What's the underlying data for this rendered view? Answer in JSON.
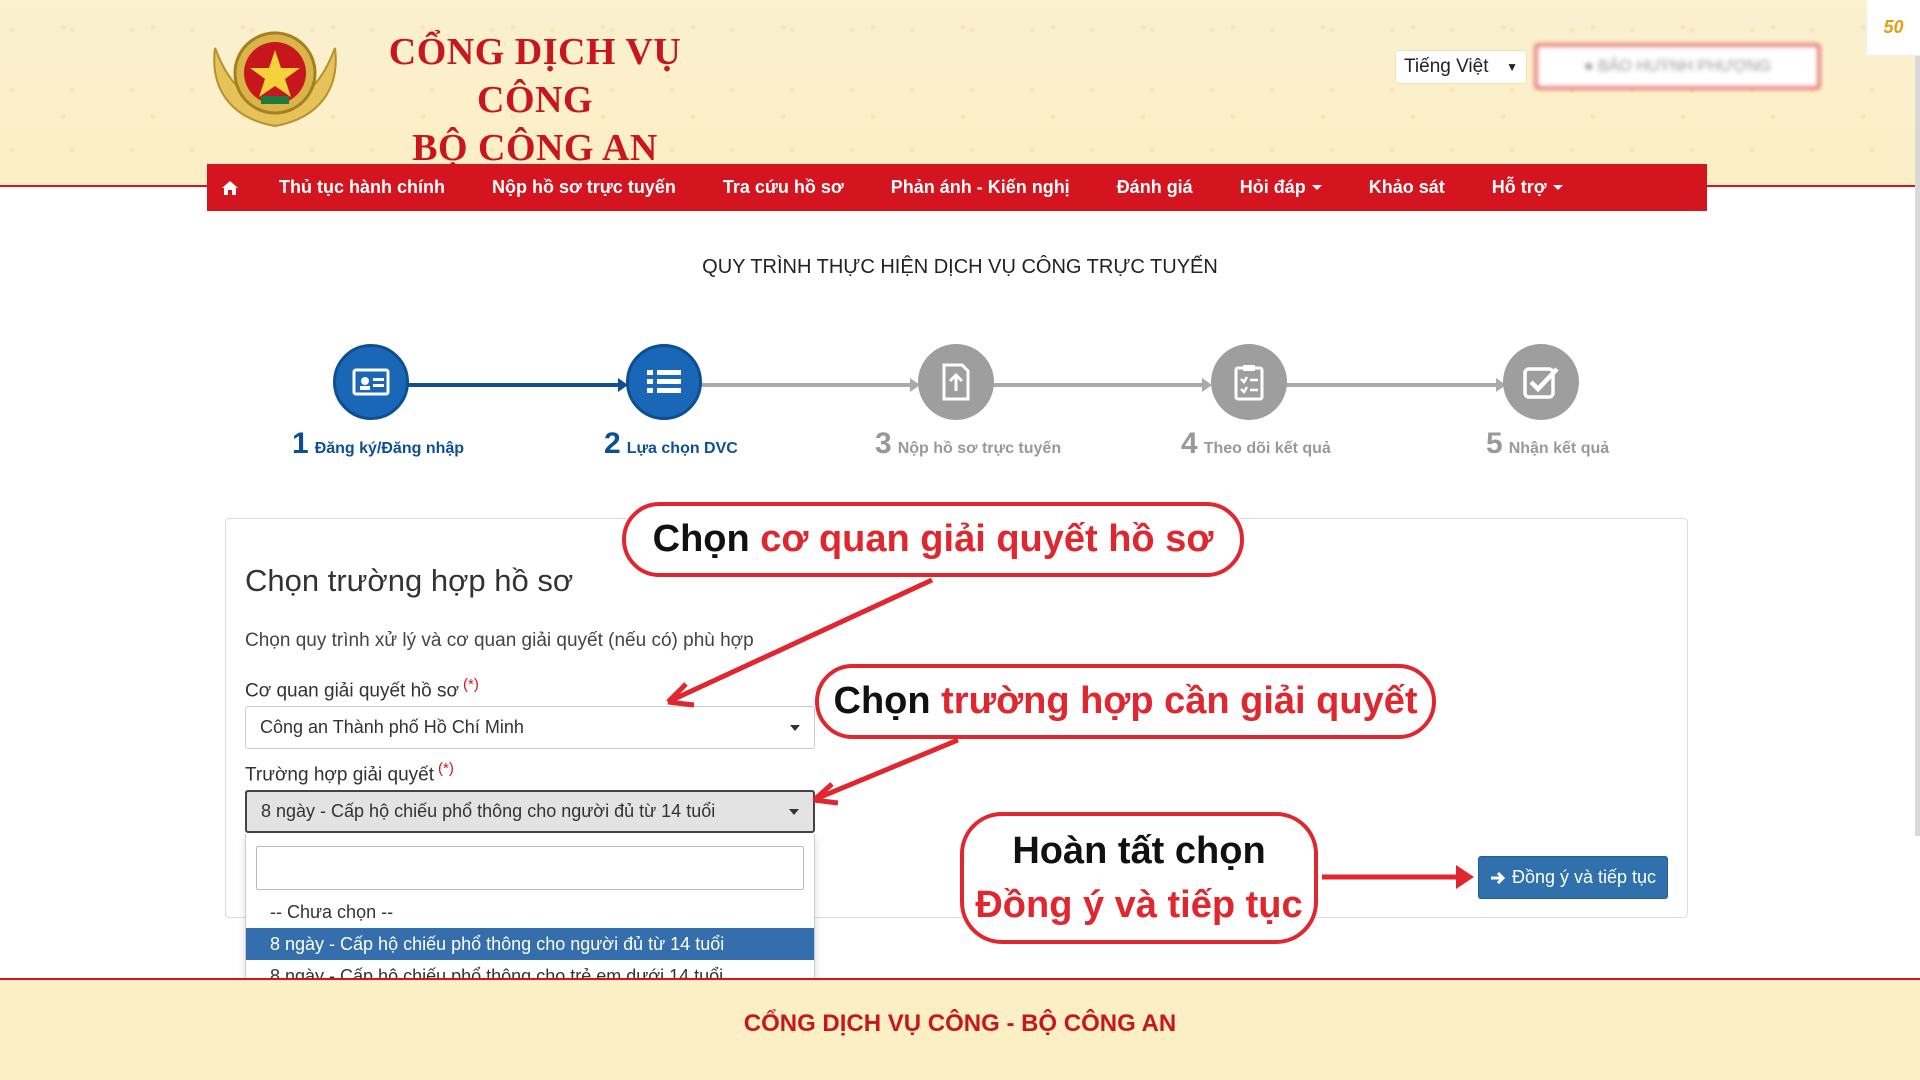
{
  "header": {
    "site_title_line1": "CỔNG DỊCH VỤ CÔNG",
    "site_title_line2": "BỘ CÔNG AN",
    "language": "Tiếng Việt",
    "user_name": "BẢO HUỲNH PHƯỢNG"
  },
  "nav": {
    "home_icon": "home-icon",
    "items": [
      {
        "label": "Thủ tục hành chính"
      },
      {
        "label": "Nộp hồ sơ trực tuyến"
      },
      {
        "label": "Tra cứu hồ sơ"
      },
      {
        "label": "Phản ánh - Kiến nghị"
      },
      {
        "label": "Đánh giá"
      },
      {
        "label": "Hỏi đáp",
        "has_dropdown": true
      },
      {
        "label": "Khảo sát"
      },
      {
        "label": "Hỗ trợ",
        "has_dropdown": true
      }
    ]
  },
  "page": {
    "subtitle": "QUY TRÌNH THỰC HIỆN DỊCH VỤ CÔNG TRỰC TUYẾN"
  },
  "steps": [
    {
      "num": "1",
      "label": "Đăng ký/Đăng nhập",
      "icon": "id-card-icon",
      "active": true
    },
    {
      "num": "2",
      "label": "Lựa chọn DVC",
      "icon": "list-icon",
      "active": true
    },
    {
      "num": "3",
      "label": "Nộp hồ sơ trực tuyến",
      "icon": "document-upload-icon",
      "active": false
    },
    {
      "num": "4",
      "label": "Theo dõi kết quả",
      "icon": "clipboard-icon",
      "active": false
    },
    {
      "num": "5",
      "label": "Nhận kết quả",
      "icon": "check-square-icon",
      "active": false
    }
  ],
  "form": {
    "title": "Chọn trường hợp hồ sơ",
    "description": "Chọn quy trình xử lý và cơ quan giải quyết (nếu có) phù hợp",
    "agency_label": "Cơ quan giải quyết hồ sơ",
    "required_mark": "(*)",
    "agency_value": "Công an Thành phố Hồ Chí Minh",
    "case_label": "Trường hợp giải quyết",
    "case_value": "8 ngày - Cấp hộ chiếu phổ thông cho người đủ từ 14 tuổi",
    "search_placeholder": "",
    "options": [
      "-- Chưa chọn --",
      "8 ngày - Cấp hộ chiếu phổ thông cho người đủ từ 14 tuổi",
      "8 ngày - Cấp hộ chiếu phổ thông cho trẻ em dưới 14 tuổi"
    ],
    "submit_label": "Đồng ý và tiếp tục"
  },
  "callouts": {
    "c1_black": "Chọn ",
    "c1_red": "cơ quan giải quyết hồ sơ",
    "c2_black": "Chọn ",
    "c2_red": "trường hợp cần giải quyết",
    "c3_black": "Hoàn tất chọn",
    "c3_red": "Đồng ý và tiếp tục"
  },
  "footer": {
    "text": "CỔNG DỊCH VỤ CÔNG - BỘ CÔNG AN"
  },
  "corner_badge": "50",
  "colors": {
    "brand_red": "#d4141e",
    "step_active": "#1a66b7",
    "step_inactive": "#9e9e9e",
    "button_blue": "#2f70ad",
    "highlight_blue": "#356eac",
    "header_bg": "#fcefc6"
  }
}
